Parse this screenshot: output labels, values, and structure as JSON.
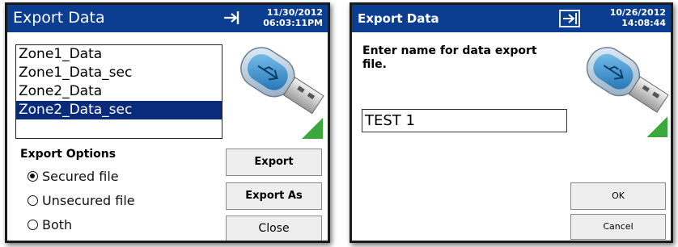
{
  "screen1": {
    "title": "Export Data",
    "date": "11/30/2012",
    "time": "06:03:11PM",
    "files": [
      "Zone1_Data",
      "Zone1_Data_sec",
      "Zone2_Data",
      "Zone2_Data_sec"
    ],
    "selected_index": 3,
    "options_label": "Export Options",
    "options": [
      {
        "label": "Secured file",
        "selected": true
      },
      {
        "label": "Unsecured file",
        "selected": false
      },
      {
        "label": "Both",
        "selected": false
      }
    ],
    "buttons": {
      "export": "Export",
      "export_as": "Export As",
      "close": "Close"
    }
  },
  "screen2": {
    "title": "Export Data",
    "date": "10/26/2012",
    "time": "14:08:44",
    "prompt": "Enter name for data export file.",
    "filename": "TEST 1",
    "buttons": {
      "ok": "OK",
      "cancel": "Cancel"
    }
  },
  "colors": {
    "titlebar": "#0b3d91",
    "selection": "#0a2a7a",
    "usb_body": "#3a8fd0",
    "indicator": "#3aa83a"
  },
  "icons": [
    "usb-symbol-icon",
    "usb-drive-icon",
    "usb-connected-icon"
  ]
}
